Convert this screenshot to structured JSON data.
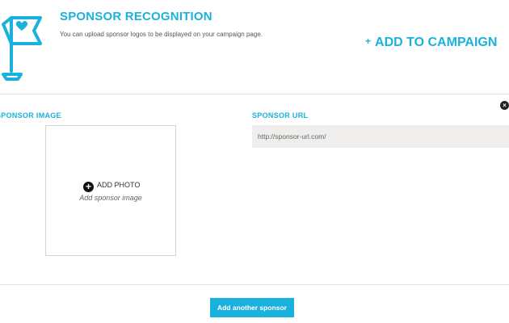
{
  "header": {
    "title": "SPONSOR RECOGNITION",
    "subtitle": "You can upload sponsor logos to be displayed on your campaign page.",
    "add_to_campaign": "ADD TO CAMPAIGN",
    "add_to_campaign_prefix": "+",
    "logo_icon": "banner-flag-heart-icon"
  },
  "sponsor": {
    "image_label": "SPONSOR IMAGE",
    "add_photo": "ADD PHOTO",
    "add_photo_hint": "Add sponsor image",
    "url_label": "SPONSOR URL",
    "url_placeholder": "http://sponsor-url.com/",
    "remove_icon": "close-circle-icon"
  },
  "footer": {
    "add_another": "Add another sponsor"
  },
  "colors": {
    "accent": "#1ab2dc",
    "input_bg": "#efeeec",
    "divider": "#e3e3e3"
  }
}
